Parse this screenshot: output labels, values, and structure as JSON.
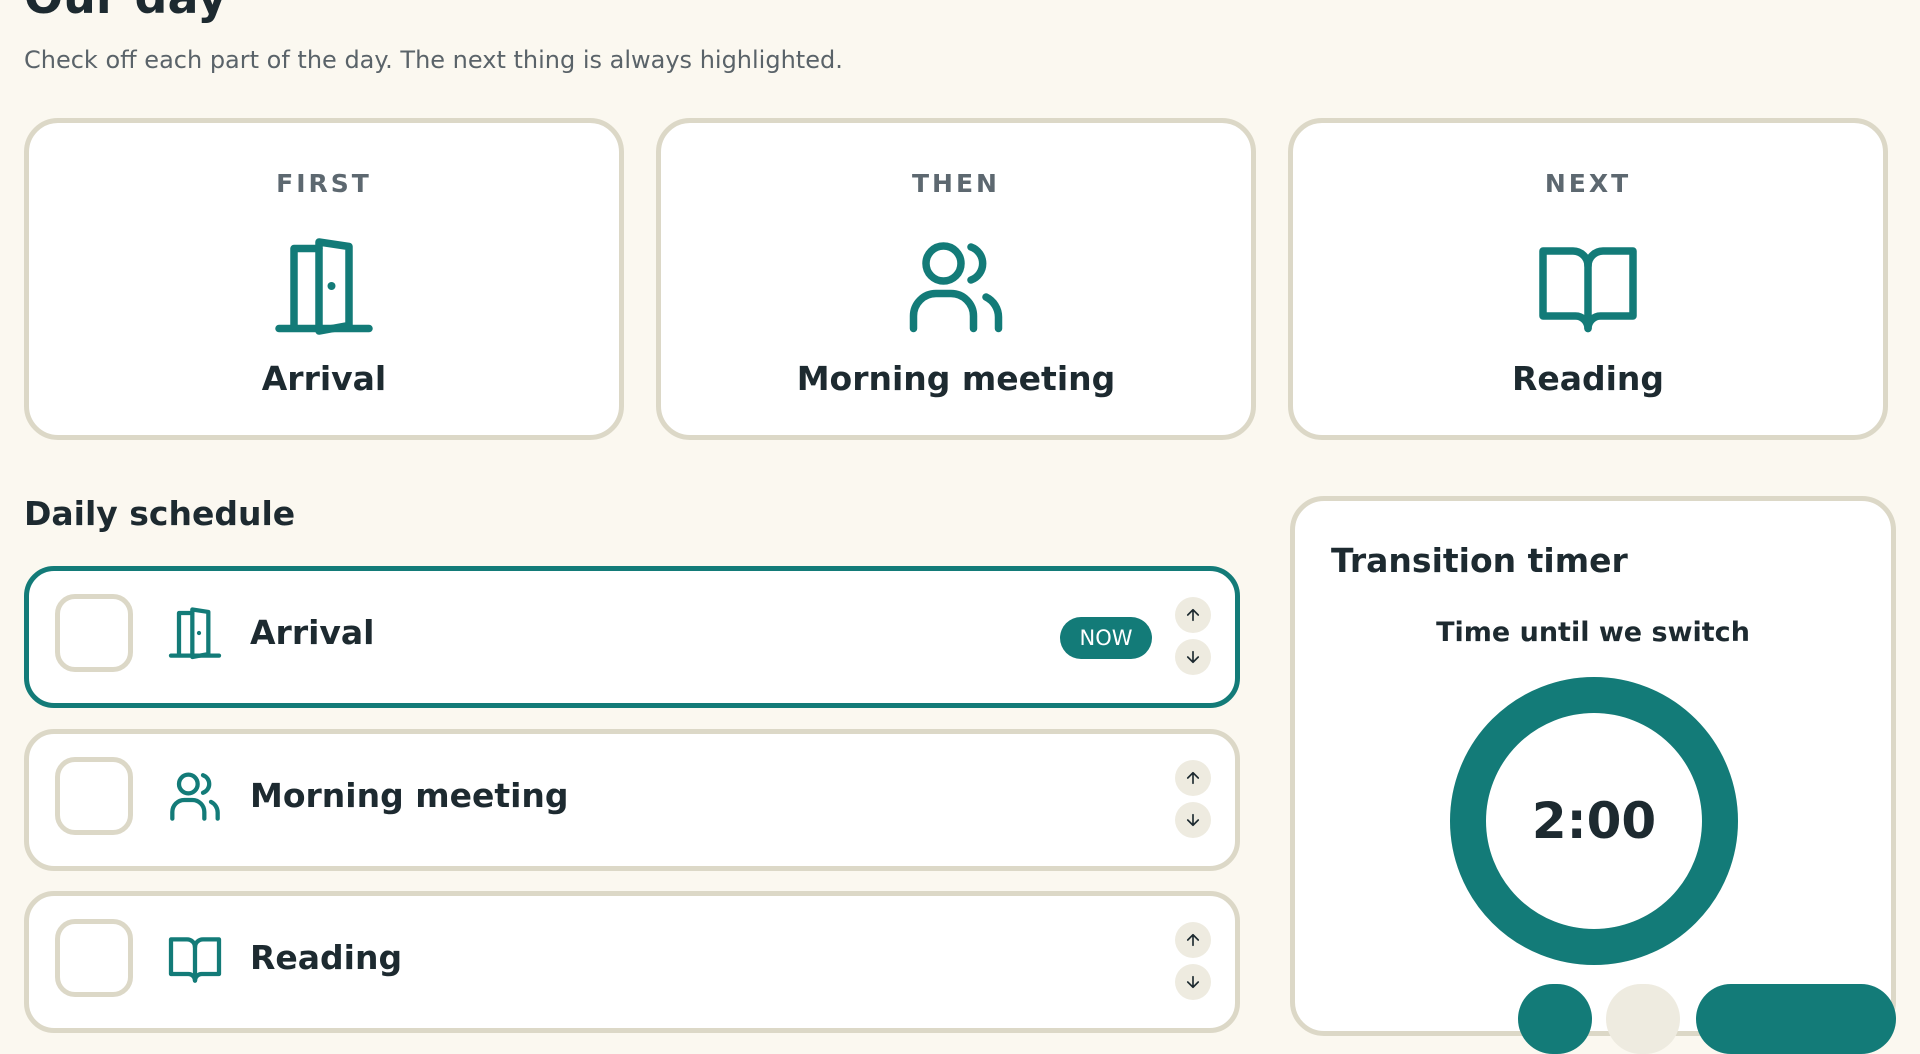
{
  "header": {
    "title": "Our day",
    "subtitle": "Check off each part of the day. The next thing is always highlighted."
  },
  "first_then_next": [
    {
      "step": "FIRST",
      "label": "Arrival",
      "icon": "door-icon"
    },
    {
      "step": "THEN",
      "label": "Morning meeting",
      "icon": "people-icon"
    },
    {
      "step": "NEXT",
      "label": "Reading",
      "icon": "book-icon"
    }
  ],
  "schedule": {
    "title": "Daily schedule",
    "now_badge": "NOW",
    "items": [
      {
        "label": "Arrival",
        "icon": "door-icon",
        "checked": false,
        "current": true
      },
      {
        "label": "Morning meeting",
        "icon": "people-icon",
        "checked": false,
        "current": false
      },
      {
        "label": "Reading",
        "icon": "book-icon",
        "checked": false,
        "current": false
      }
    ]
  },
  "timer": {
    "title": "Transition timer",
    "caption": "Time until we switch",
    "display": "2:00",
    "progress": 1.0
  },
  "colors": {
    "accent": "#137b78",
    "border": "#dcd8c7",
    "background": "#fbf8f0",
    "text": "#1d2a30"
  }
}
